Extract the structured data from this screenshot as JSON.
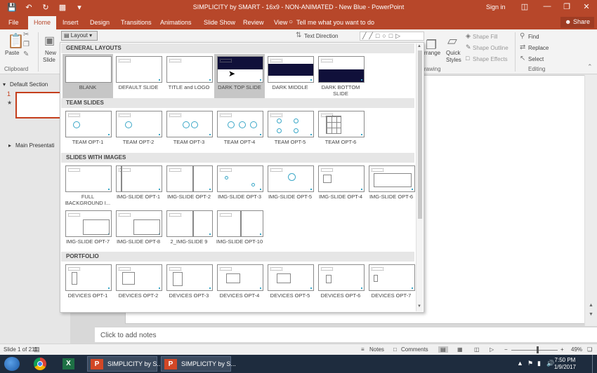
{
  "titlebar": {
    "title": "SIMPLICITY by SMART - 16x9 - NON-ANIMATED - New Blue  -  PowerPoint",
    "signin": "Sign in"
  },
  "tabs": [
    "File",
    "Home",
    "Insert",
    "Design",
    "Transitions",
    "Animations",
    "Slide Show",
    "Review",
    "View"
  ],
  "tell_me": "Tell me what you want to do",
  "share": "Share",
  "ribbon": {
    "paste": "Paste",
    "new_slide": "New",
    "new_slide2": "Slide",
    "clipboard": "Clipboard",
    "layout": "Layout",
    "text_direction": "Text Direction",
    "arrange": "rrange",
    "quick_styles": "Quick",
    "quick_styles2": "Styles",
    "drawing": "rawing",
    "shape_fill": "Shape Fill",
    "shape_outline": "Shape Outline",
    "shape_effects": "Shape Effects",
    "find": "Find",
    "replace": "Replace",
    "select": "Select",
    "editing": "Editing"
  },
  "slide_pane": {
    "default_section": "Default Section",
    "main_section": "Main Presentati",
    "slide_number": "1"
  },
  "notes_placeholder": "Click to add notes",
  "status": {
    "slide_count": "Slide 1 of 211",
    "notes": "Notes",
    "comments": "Comments",
    "zoom": "49%",
    "zoom_level": 0.49
  },
  "taskbar": {
    "win1": "SIMPLICITY by S...",
    "win2": "SIMPLICITY by S...",
    "time": "7:50 PM",
    "date": "1/9/2017"
  },
  "gallery": {
    "sections": [
      {
        "title": "GENERAL LAYOUTS",
        "items": [
          "BLANK",
          "DEFAULT SLIDE",
          "TITLE and LOGO",
          "DARK TOP SLIDE",
          "DARK MIDDLE",
          "DARK BOTTOM SLIDE"
        ]
      },
      {
        "title": "TEAM SLIDES",
        "items": [
          "TEAM OPT-1",
          "TEAM OPT-2",
          "TEAM OPT-3",
          "TEAM OPT-4",
          "TEAM OPT-5",
          "TEAM OPT-6"
        ]
      },
      {
        "title": "SLIDES WITH IMAGES",
        "items": [
          "FULL BACKGROUND I...",
          "IMG-SLIDE OPT-1",
          "IMG-SLIDE OPT-2",
          "IMG-SLIDE OPT-3",
          "IMG-SLIDE OPT-5",
          "IMG-SLIDE OPT-4",
          "IMG-SLIDE OPT-6",
          "IMG-SLIDE OPT-7",
          "IMG-SLIDE OPT-8",
          "2_IMG-SLIDE 9",
          "IMG-SLIDE OPT-10"
        ]
      },
      {
        "title": "PORTFOLIO",
        "items": [
          "DEVICES OPT-1",
          "DEVICES OPT-2",
          "DEVICES OPT-3",
          "DEVICES OPT-4",
          "DEVICES OPT-5",
          "DEVICES OPT-6",
          "DEVICES OPT-7"
        ]
      }
    ]
  },
  "colors": {
    "accent": "#b7472a",
    "dark_slide": "#10103a",
    "placeholder_teal": "#3aa7c7"
  }
}
